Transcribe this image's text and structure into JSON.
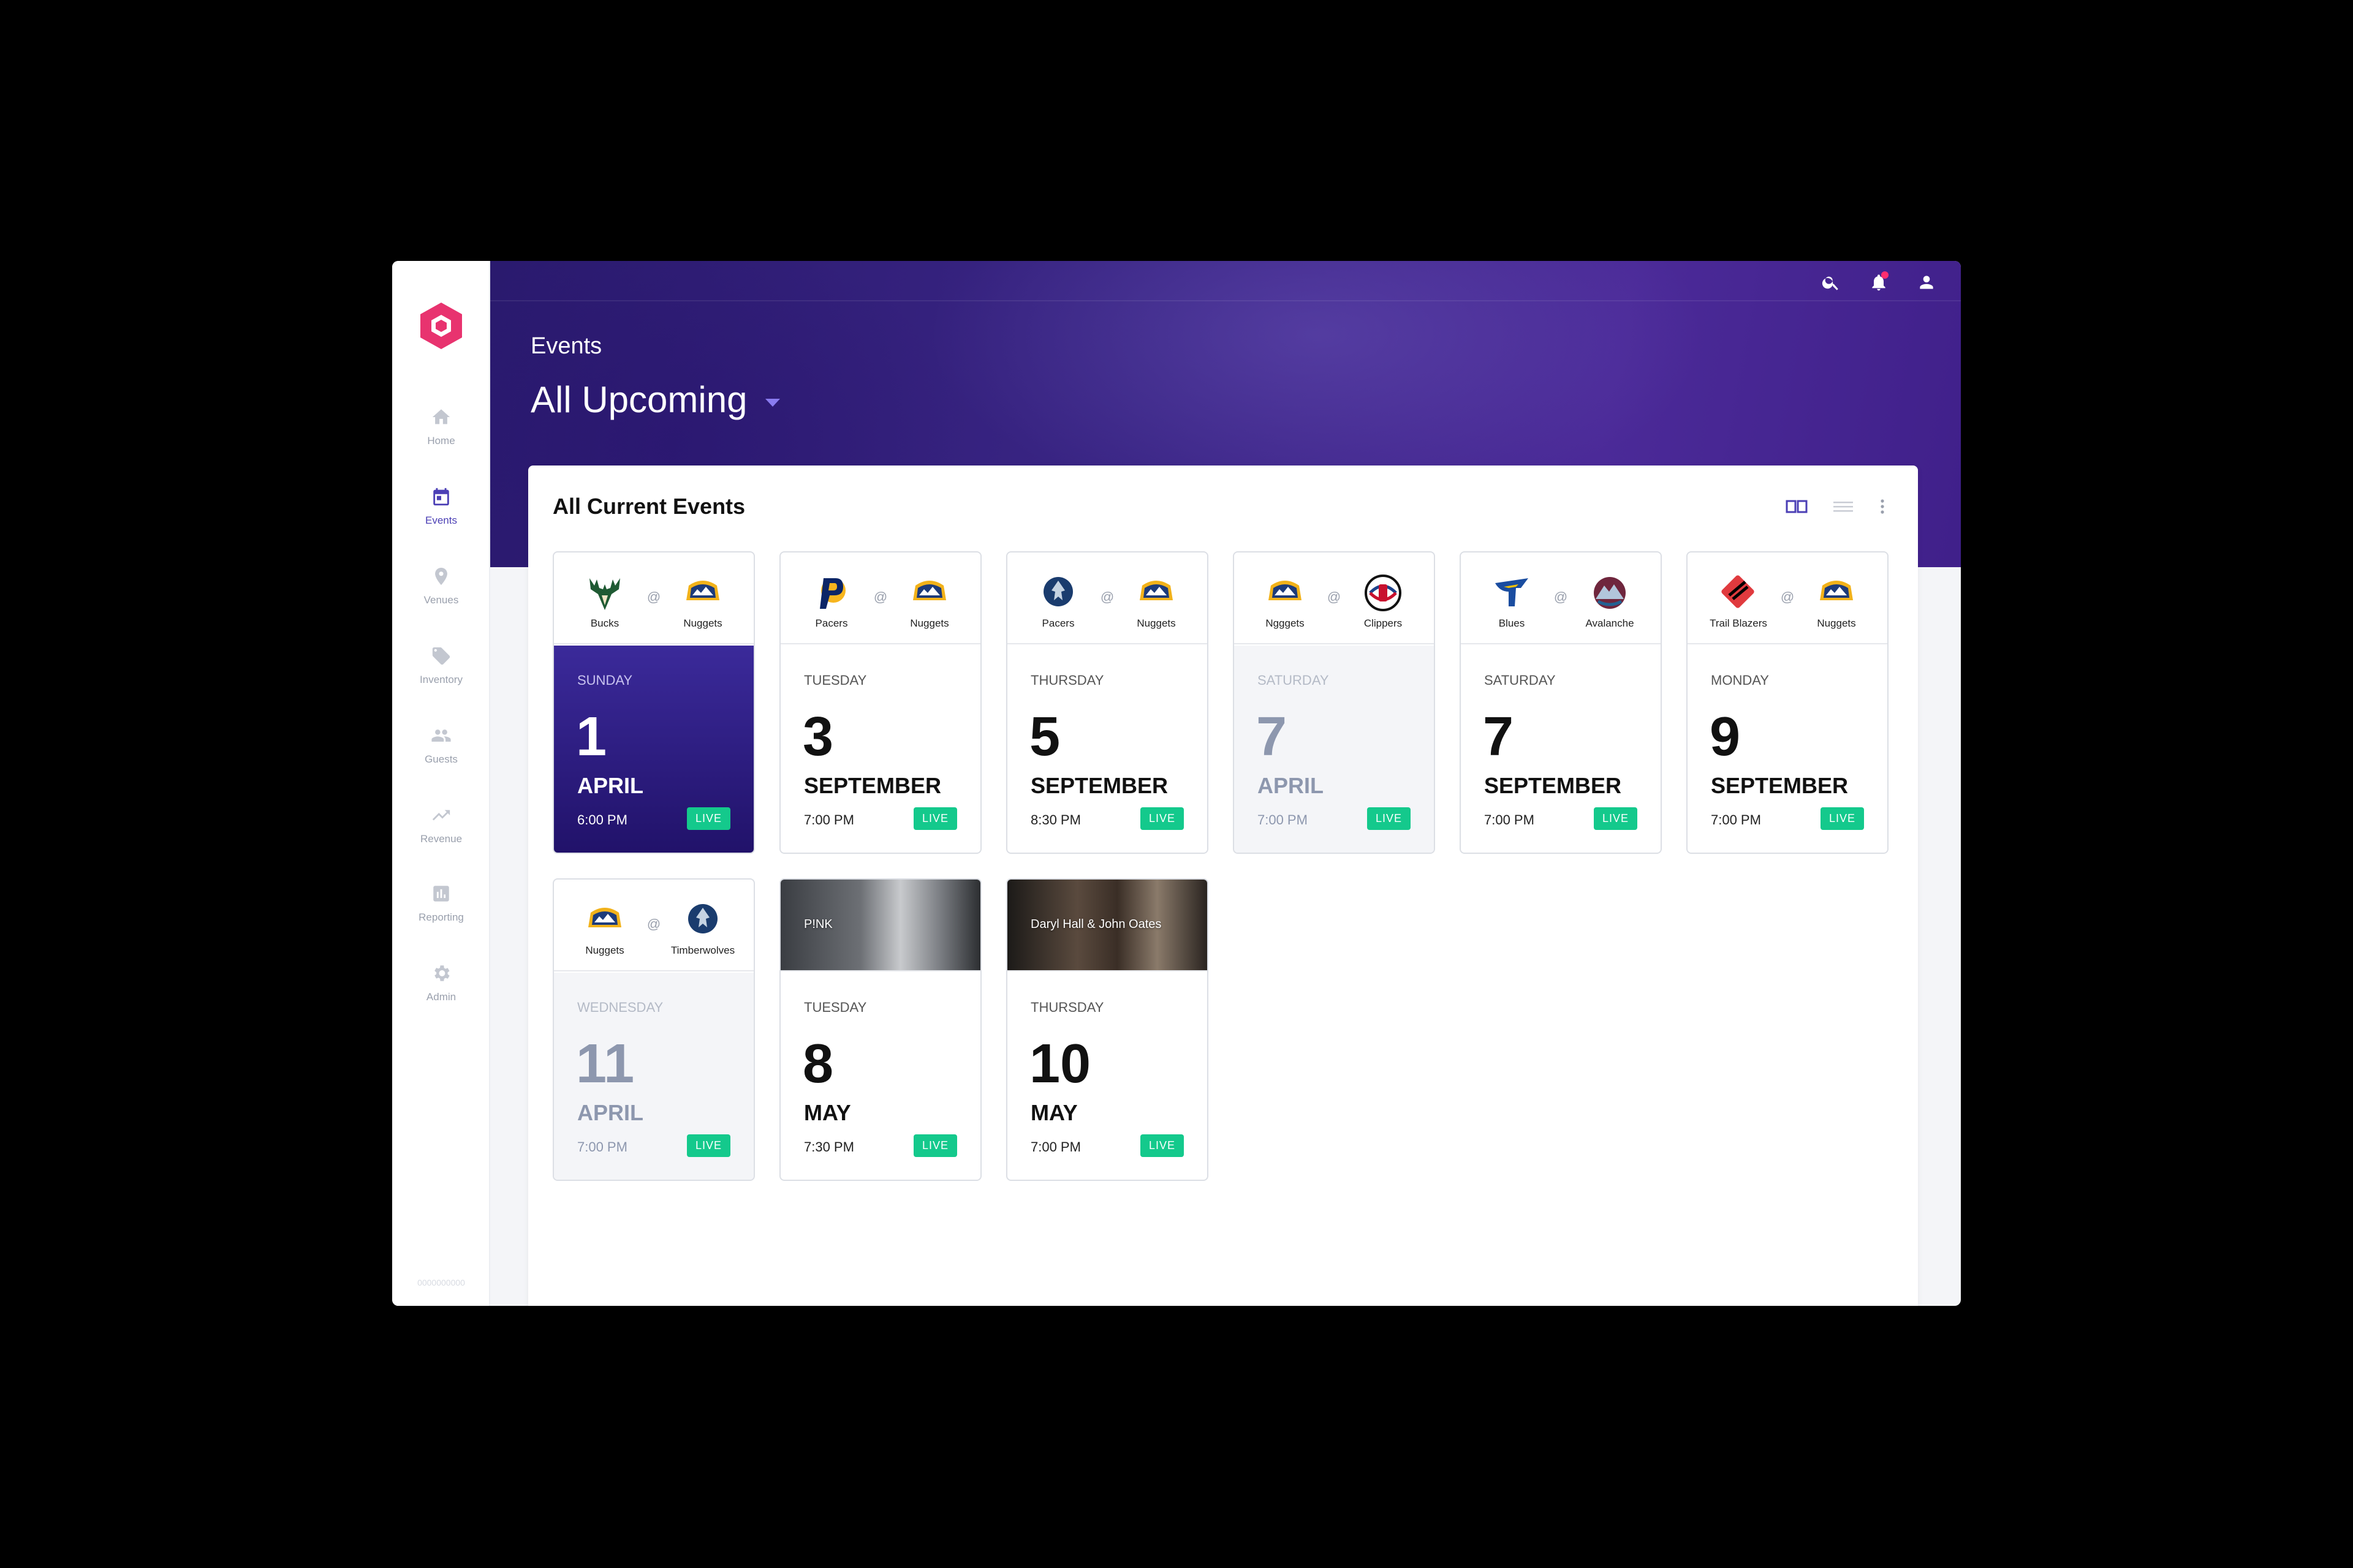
{
  "sidebar": {
    "items": [
      {
        "label": "Home",
        "icon": "home-icon"
      },
      {
        "label": "Events",
        "icon": "calendar-icon",
        "active": true
      },
      {
        "label": "Venues",
        "icon": "location-pin-icon"
      },
      {
        "label": "Inventory",
        "icon": "tag-icon"
      },
      {
        "label": "Guests",
        "icon": "people-icon"
      },
      {
        "label": "Revenue",
        "icon": "trending-icon"
      },
      {
        "label": "Reporting",
        "icon": "bar-chart-icon"
      },
      {
        "label": "Admin",
        "icon": "gear-icon"
      }
    ],
    "footer": "0000000000"
  },
  "header": {
    "breadcrumb": "Events",
    "title": "All Upcoming"
  },
  "panel": {
    "title": "All Current Events"
  },
  "colors": {
    "accent": "#4b3fb5",
    "live": "#14c98c",
    "logo": "#e8336f"
  },
  "events": [
    {
      "away": "Bucks",
      "home": "Nuggets",
      "at": "@",
      "dow": "SUNDAY",
      "day": "1",
      "month": "APRIL",
      "time": "6:00 PM",
      "status": "LIVE"
    },
    {
      "away": "Pacers",
      "home": "Nuggets",
      "at": "@",
      "dow": "TUESDAY",
      "day": "3",
      "month": "SEPTEMBER",
      "time": "7:00 PM",
      "status": "LIVE"
    },
    {
      "away": "Pacers",
      "home": "Nuggets",
      "at": "@",
      "dow": "THURSDAY",
      "day": "5",
      "month": "SEPTEMBER",
      "time": "8:30 PM",
      "status": "LIVE"
    },
    {
      "away": "Ngggets",
      "home": "Clippers",
      "at": "@",
      "dow": "SATURDAY",
      "day": "7",
      "month": "APRIL",
      "time": "7:00 PM",
      "status": "LIVE"
    },
    {
      "away": "Blues",
      "home": "Avalanche",
      "at": "@",
      "dow": "SATURDAY",
      "day": "7",
      "month": "SEPTEMBER",
      "time": "7:00 PM",
      "status": "LIVE"
    },
    {
      "away": "Trail Blazers",
      "home": "Nuggets",
      "at": "@",
      "dow": "MONDAY",
      "day": "9",
      "month": "SEPTEMBER",
      "time": "7:00 PM",
      "status": "LIVE"
    },
    {
      "away": "Nuggets",
      "home": "Timberwolves",
      "at": "@",
      "dow": "WEDNESDAY",
      "day": "11",
      "month": "APRIL",
      "time": "7:00 PM",
      "status": "LIVE"
    },
    {
      "artist": "P!NK",
      "dow": "TUESDAY",
      "day": "8",
      "month": "MAY",
      "time": "7:30 PM",
      "status": "LIVE"
    },
    {
      "artist": "Daryl Hall & John Oates",
      "dow": "THURSDAY",
      "day": "10",
      "month": "MAY",
      "time": "7:00 PM",
      "status": "LIVE"
    }
  ]
}
